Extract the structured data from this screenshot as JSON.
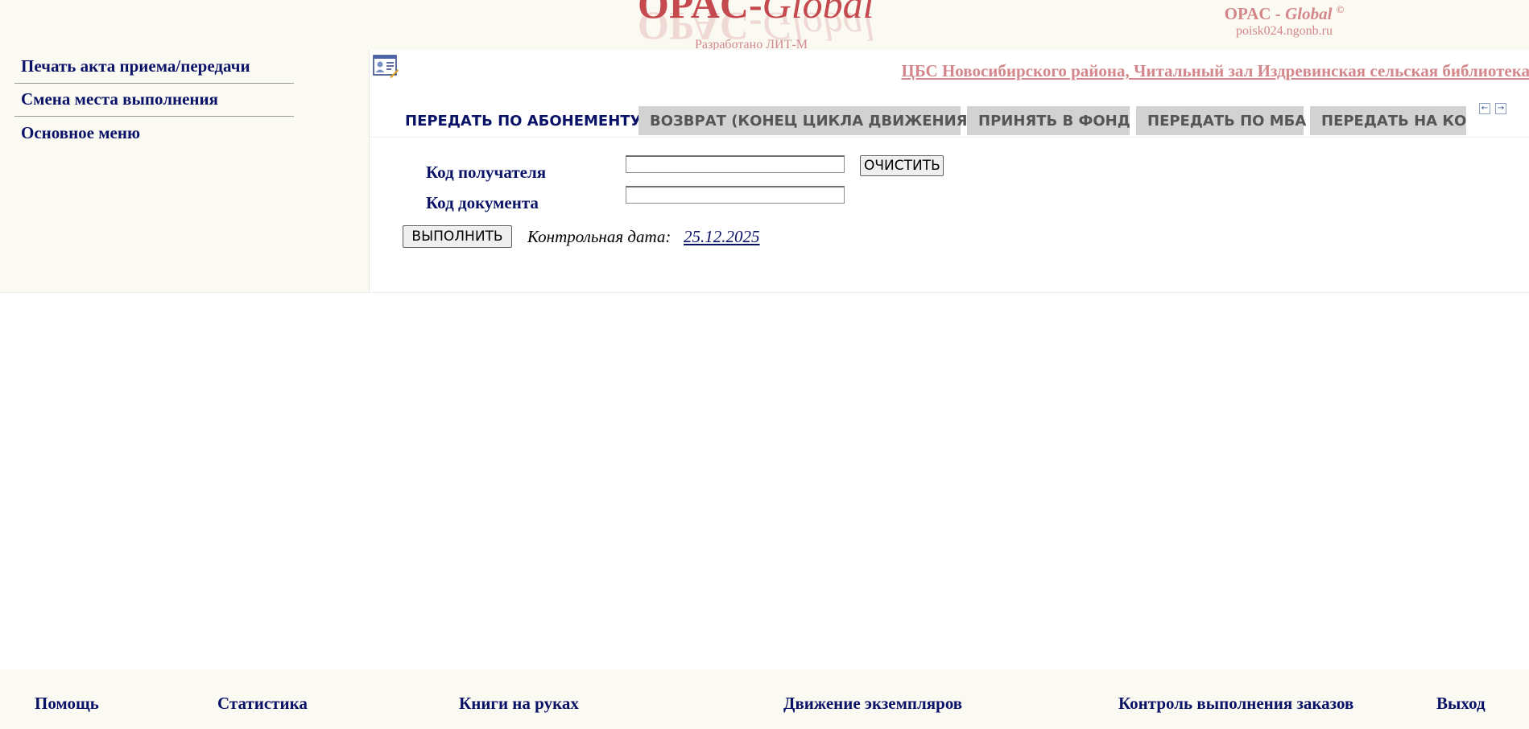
{
  "header": {
    "logo": {
      "main": "OPAC-",
      "main_italic": "Global",
      "developer": "Разработано ЛИТ-М"
    },
    "brand": {
      "prefix": "OPAC - ",
      "italic": "Global",
      "copyright": "©",
      "host": "poisk024.ngonb.ru"
    }
  },
  "sidebar": {
    "items": [
      {
        "label": "Печать акта приема/передачи"
      },
      {
        "label": "Смена места выполнения"
      },
      {
        "label": "Основное меню"
      }
    ]
  },
  "main": {
    "location": "ЦБС Новосибирского района, Читальный зал Издревинская сельская библиотека",
    "tabs": [
      {
        "label": "ПЕРЕДАТЬ ПО АБОНЕМЕНТУ",
        "active": true
      },
      {
        "label": "ВОЗВРАТ (КОНЕЦ ЦИКЛА ДВИЖЕНИЯ)",
        "active": false
      },
      {
        "label": "ПРИНЯТЬ В ФОНД",
        "active": false
      },
      {
        "label": "ПЕРЕДАТЬ ПО МБА",
        "active": false
      },
      {
        "label": "ПЕРЕДАТЬ НА КОЛИЧЕСТВЕННЫЙ УЧЕТ",
        "active": false
      }
    ],
    "scroll_left_glyph": "←",
    "scroll_right_glyph": "→",
    "form": {
      "recipient_label": "Код получателя",
      "recipient_value": "",
      "document_label": "Код документа",
      "document_value": "",
      "clear_button": "ОЧИСТИТЬ",
      "execute_button": "ВЫПОЛНИТЬ",
      "control_date_label": "Контрольная дата:",
      "control_date_value": "25.12.2025"
    }
  },
  "footer": {
    "items": [
      {
        "label": "Помощь"
      },
      {
        "label": "Статистика"
      },
      {
        "label": "Книги на руках"
      },
      {
        "label": "Движение экземпляров"
      },
      {
        "label": "Контроль выполнения заказов"
      },
      {
        "label": "Выход"
      }
    ]
  },
  "colors": {
    "nav_text": "#0a1268",
    "logo_red": "#c44a4f",
    "brand_pink": "#d4878b",
    "panel_bg": "#faf9f2",
    "tab_bg": "#d2d2d2"
  }
}
